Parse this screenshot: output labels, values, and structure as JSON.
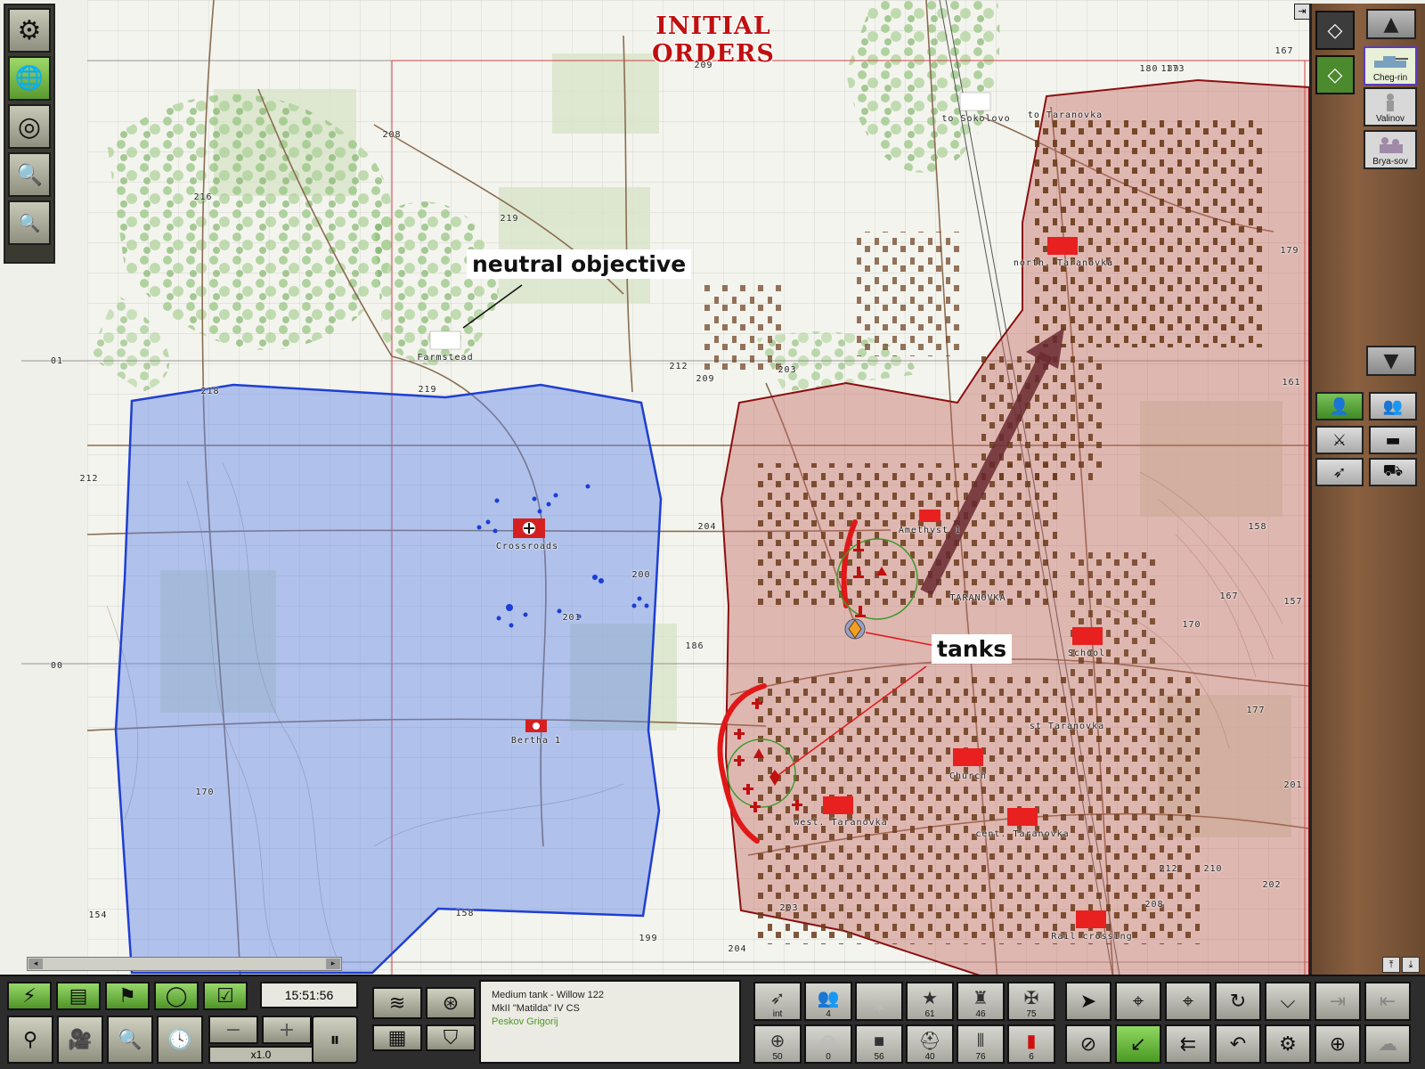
{
  "map": {
    "title": "INITIAL ORDERS",
    "place_labels": {
      "farmstead": "Farmstead",
      "crossroads": "Crossroads",
      "bertha": "Bertha 1",
      "amethyst": "Amethyst 1",
      "taranovka": "TARANOVKA",
      "school": "School",
      "church": "Church",
      "west_taranovka": "west. Taranovka",
      "cent_taranovka": "cent. Taranovka",
      "rail_crossing": "Rail crossing",
      "north_taranovka": "north. Taranovka",
      "sokolovo": "to Sokolovo",
      "to_taranovka_top": "to Taranovka",
      "st_taranovka": "st Taranovka"
    },
    "elevations": {
      "e209": "209",
      "e208": "208",
      "e216": "216",
      "e219a": "219",
      "e219b": "219",
      "e218": "218",
      "e212a": "212",
      "e212b": "212",
      "e209b": "209",
      "e203": "203",
      "e204": "204",
      "e200": "200",
      "e201": "201",
      "e186": "186",
      "e170": "170",
      "e158": "158",
      "e154": "154",
      "e199": "199",
      "e203b": "203",
      "e204b": "204",
      "e189": "189",
      "e180": "180",
      "e173": "173",
      "e167": "167",
      "e179": "179",
      "e161": "161",
      "e158b": "158",
      "e167b": "167",
      "e157": "157",
      "e170b": "170",
      "e177": "177",
      "e201b": "201",
      "e212c": "212",
      "e210": "210",
      "e202": "202",
      "e208b": "208",
      "grid01": "01",
      "grid00": "00",
      "grid01b": "01"
    },
    "annotations": {
      "neutral": "neutral objective",
      "tanks": "tanks"
    }
  },
  "left_toolbar": {
    "settings": "⚙",
    "globe": "🌐",
    "radar": "◎",
    "zoom_in": "🔍",
    "zoom_out": "🔍"
  },
  "right_panel": {
    "units": [
      {
        "label": "Cheg-rin"
      },
      {
        "label": "Valinov"
      },
      {
        "label": "Brya-sov"
      }
    ]
  },
  "bottom": {
    "clock": "15:51:56",
    "speed": "x1.0",
    "unit_info": {
      "line1": "Medium tank - Willow 122",
      "line2": "MkII \"Matilda\" IV CS",
      "commander": "Peskov Grigorij"
    },
    "stats_top": [
      {
        "label": "int",
        "icon": "➶"
      },
      {
        "label": "4",
        "icon": "👥"
      },
      {
        "label": "",
        "icon": "✶",
        "faded": true
      },
      {
        "label": "61",
        "icon": "★"
      },
      {
        "label": "46",
        "icon": "♜"
      },
      {
        "label": "75",
        "icon": "✠"
      }
    ],
    "stats_bottom": [
      {
        "label": "50",
        "icon": "⊕"
      },
      {
        "label": "0",
        "icon": "◍",
        "faded": true
      },
      {
        "label": "56",
        "icon": "■"
      },
      {
        "label": "40",
        "icon": "⛑"
      },
      {
        "label": "76",
        "icon": "⦀"
      },
      {
        "label": "6",
        "icon": "▮",
        "red": true
      }
    ]
  },
  "colors": {
    "blue_zone": "#5e82e6",
    "red_zone": "#c0625e",
    "title": "#c01010",
    "arrow": "#6a2a30"
  }
}
